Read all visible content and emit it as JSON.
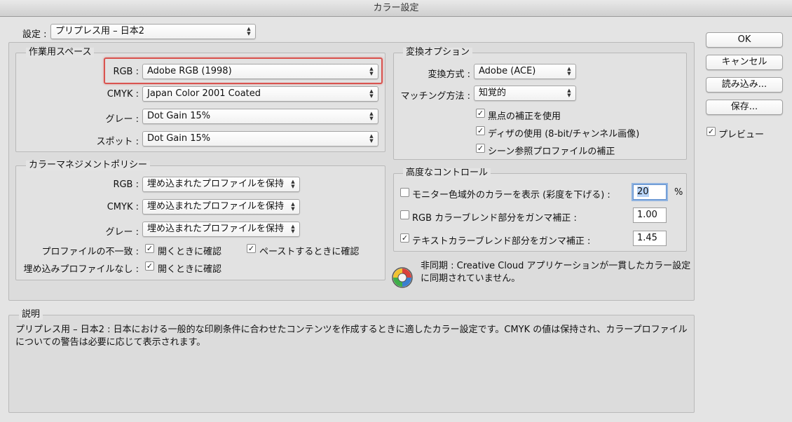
{
  "window": {
    "title": "カラー設定"
  },
  "settings": {
    "label": "設定 :",
    "value": "プリプレス用 – 日本2"
  },
  "working_spaces": {
    "title": "作業用スペース",
    "rgb": {
      "label": "RGB :",
      "value": "Adobe RGB (1998)"
    },
    "cmyk": {
      "label": "CMYK :",
      "value": "Japan Color 2001 Coated"
    },
    "gray": {
      "label": "グレー :",
      "value": "Dot Gain 15%"
    },
    "spot": {
      "label": "スポット :",
      "value": "Dot Gain 15%"
    }
  },
  "policies": {
    "title": "カラーマネジメントポリシー",
    "rgb": {
      "label": "RGB :",
      "value": "埋め込まれたプロファイルを保持"
    },
    "cmyk": {
      "label": "CMYK :",
      "value": "埋め込まれたプロファイルを保持"
    },
    "gray": {
      "label": "グレー :",
      "value": "埋め込まれたプロファイルを保持"
    },
    "mismatch_label": "プロファイルの不一致 :",
    "mismatch_open": {
      "label": "開くときに確認",
      "checked": true
    },
    "mismatch_paste": {
      "label": "ペーストするときに確認",
      "checked": true
    },
    "missing_label": "埋め込みプロファイルなし :",
    "missing_open": {
      "label": "開くときに確認",
      "checked": true
    }
  },
  "conversion": {
    "title": "変換オプション",
    "engine": {
      "label": "変換方式 :",
      "value": "Adobe (ACE)"
    },
    "intent": {
      "label": "マッチング方法 :",
      "value": "知覚的"
    },
    "bpc": {
      "label": "黒点の補正を使用",
      "checked": true
    },
    "dither": {
      "label": "ディザの使用 (8-bit/チャンネル画像)",
      "checked": true
    },
    "scene": {
      "label": "シーン参照プロファイルの補正",
      "checked": true
    }
  },
  "advanced": {
    "title": "高度なコントロール",
    "desaturate": {
      "label": "モニター色域外のカラーを表示 (彩度を下げる) :",
      "value": "20",
      "unit": "%",
      "checked": false
    },
    "blend_rgb": {
      "label": "RGB カラーブレンド部分をガンマ補正 :",
      "value": "1.00",
      "checked": false
    },
    "blend_text": {
      "label": "テキストカラーブレンド部分をガンマ補正 :",
      "value": "1.45",
      "checked": true
    }
  },
  "sync": {
    "line1": "非同期 : Creative Cloud アプリケーションが一貫したカラー設定",
    "line2": "に同期されていません。"
  },
  "description": {
    "title": "説明",
    "line1": "プリプレス用 – 日本2 :  日本における一般的な印刷条件に合わせたコンテンツを作成するときに適したカラー設定です。CMYK の値は保持され、カラープロファイル",
    "line2": "についての警告は必要に応じて表示されます。"
  },
  "buttons": {
    "ok": "OK",
    "cancel": "キャンセル",
    "load": "読み込み...",
    "save": "保存..."
  },
  "preview": {
    "label": "プレビュー",
    "checked": true
  },
  "check_glyph": "✓",
  "arrows_glyph": "▲▼",
  "colors": {
    "highlight": "#d9534f",
    "focus": "#8fb3e0"
  }
}
